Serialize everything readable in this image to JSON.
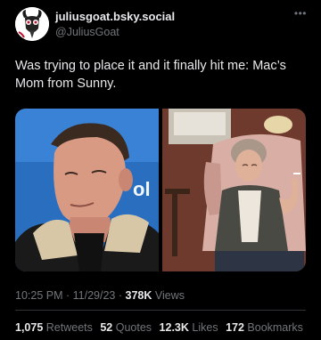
{
  "author": {
    "display_name": "juliusgoat.bsky.social",
    "handle": "@JuliusGoat",
    "avatar_icon": "goat-face-icon"
  },
  "more_icon": "more-options-icon",
  "tweet": {
    "text": "Was trying to place it and it finally hit me: Mac’s Mom from Sunny."
  },
  "media": {
    "left_image": "man-in-shearling-jacket-photo",
    "right_image": "woman-in-armchair-with-popcorn-photo"
  },
  "meta": {
    "time": "10:25 PM",
    "separator1": "·",
    "date": "11/29/23",
    "separator2": "·",
    "views_count": "378K",
    "views_label": "Views"
  },
  "stats": {
    "retweets_count": "1,075",
    "retweets_label": "Retweets",
    "quotes_count": "52",
    "quotes_label": "Quotes",
    "likes_count": "12.3K",
    "likes_label": "Likes",
    "bookmarks_count": "172",
    "bookmarks_label": "Bookmarks"
  },
  "colors": {
    "background": "#000000",
    "primary_text": "#e7e9ea",
    "secondary_text": "#71767b",
    "divider": "#2f3336"
  }
}
